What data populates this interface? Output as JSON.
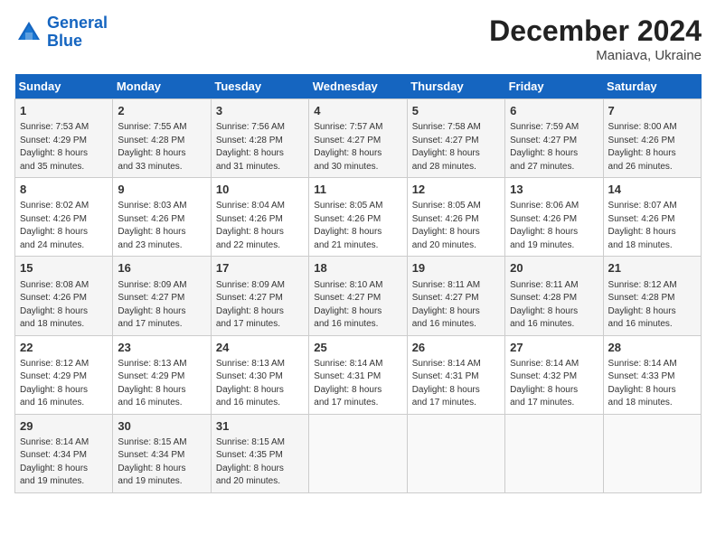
{
  "header": {
    "logo_line1": "General",
    "logo_line2": "Blue",
    "title": "December 2024",
    "subtitle": "Maniava, Ukraine"
  },
  "days_of_week": [
    "Sunday",
    "Monday",
    "Tuesday",
    "Wednesday",
    "Thursday",
    "Friday",
    "Saturday"
  ],
  "weeks": [
    [
      {
        "day": "1",
        "info": "Sunrise: 7:53 AM\nSunset: 4:29 PM\nDaylight: 8 hours\nand 35 minutes."
      },
      {
        "day": "2",
        "info": "Sunrise: 7:55 AM\nSunset: 4:28 PM\nDaylight: 8 hours\nand 33 minutes."
      },
      {
        "day": "3",
        "info": "Sunrise: 7:56 AM\nSunset: 4:28 PM\nDaylight: 8 hours\nand 31 minutes."
      },
      {
        "day": "4",
        "info": "Sunrise: 7:57 AM\nSunset: 4:27 PM\nDaylight: 8 hours\nand 30 minutes."
      },
      {
        "day": "5",
        "info": "Sunrise: 7:58 AM\nSunset: 4:27 PM\nDaylight: 8 hours\nand 28 minutes."
      },
      {
        "day": "6",
        "info": "Sunrise: 7:59 AM\nSunset: 4:27 PM\nDaylight: 8 hours\nand 27 minutes."
      },
      {
        "day": "7",
        "info": "Sunrise: 8:00 AM\nSunset: 4:26 PM\nDaylight: 8 hours\nand 26 minutes."
      }
    ],
    [
      {
        "day": "8",
        "info": "Sunrise: 8:02 AM\nSunset: 4:26 PM\nDaylight: 8 hours\nand 24 minutes."
      },
      {
        "day": "9",
        "info": "Sunrise: 8:03 AM\nSunset: 4:26 PM\nDaylight: 8 hours\nand 23 minutes."
      },
      {
        "day": "10",
        "info": "Sunrise: 8:04 AM\nSunset: 4:26 PM\nDaylight: 8 hours\nand 22 minutes."
      },
      {
        "day": "11",
        "info": "Sunrise: 8:05 AM\nSunset: 4:26 PM\nDaylight: 8 hours\nand 21 minutes."
      },
      {
        "day": "12",
        "info": "Sunrise: 8:05 AM\nSunset: 4:26 PM\nDaylight: 8 hours\nand 20 minutes."
      },
      {
        "day": "13",
        "info": "Sunrise: 8:06 AM\nSunset: 4:26 PM\nDaylight: 8 hours\nand 19 minutes."
      },
      {
        "day": "14",
        "info": "Sunrise: 8:07 AM\nSunset: 4:26 PM\nDaylight: 8 hours\nand 18 minutes."
      }
    ],
    [
      {
        "day": "15",
        "info": "Sunrise: 8:08 AM\nSunset: 4:26 PM\nDaylight: 8 hours\nand 18 minutes."
      },
      {
        "day": "16",
        "info": "Sunrise: 8:09 AM\nSunset: 4:27 PM\nDaylight: 8 hours\nand 17 minutes."
      },
      {
        "day": "17",
        "info": "Sunrise: 8:09 AM\nSunset: 4:27 PM\nDaylight: 8 hours\nand 17 minutes."
      },
      {
        "day": "18",
        "info": "Sunrise: 8:10 AM\nSunset: 4:27 PM\nDaylight: 8 hours\nand 16 minutes."
      },
      {
        "day": "19",
        "info": "Sunrise: 8:11 AM\nSunset: 4:27 PM\nDaylight: 8 hours\nand 16 minutes."
      },
      {
        "day": "20",
        "info": "Sunrise: 8:11 AM\nSunset: 4:28 PM\nDaylight: 8 hours\nand 16 minutes."
      },
      {
        "day": "21",
        "info": "Sunrise: 8:12 AM\nSunset: 4:28 PM\nDaylight: 8 hours\nand 16 minutes."
      }
    ],
    [
      {
        "day": "22",
        "info": "Sunrise: 8:12 AM\nSunset: 4:29 PM\nDaylight: 8 hours\nand 16 minutes."
      },
      {
        "day": "23",
        "info": "Sunrise: 8:13 AM\nSunset: 4:29 PM\nDaylight: 8 hours\nand 16 minutes."
      },
      {
        "day": "24",
        "info": "Sunrise: 8:13 AM\nSunset: 4:30 PM\nDaylight: 8 hours\nand 16 minutes."
      },
      {
        "day": "25",
        "info": "Sunrise: 8:14 AM\nSunset: 4:31 PM\nDaylight: 8 hours\nand 17 minutes."
      },
      {
        "day": "26",
        "info": "Sunrise: 8:14 AM\nSunset: 4:31 PM\nDaylight: 8 hours\nand 17 minutes."
      },
      {
        "day": "27",
        "info": "Sunrise: 8:14 AM\nSunset: 4:32 PM\nDaylight: 8 hours\nand 17 minutes."
      },
      {
        "day": "28",
        "info": "Sunrise: 8:14 AM\nSunset: 4:33 PM\nDaylight: 8 hours\nand 18 minutes."
      }
    ],
    [
      {
        "day": "29",
        "info": "Sunrise: 8:14 AM\nSunset: 4:34 PM\nDaylight: 8 hours\nand 19 minutes."
      },
      {
        "day": "30",
        "info": "Sunrise: 8:15 AM\nSunset: 4:34 PM\nDaylight: 8 hours\nand 19 minutes."
      },
      {
        "day": "31",
        "info": "Sunrise: 8:15 AM\nSunset: 4:35 PM\nDaylight: 8 hours\nand 20 minutes."
      },
      {
        "day": "",
        "info": ""
      },
      {
        "day": "",
        "info": ""
      },
      {
        "day": "",
        "info": ""
      },
      {
        "day": "",
        "info": ""
      }
    ]
  ]
}
